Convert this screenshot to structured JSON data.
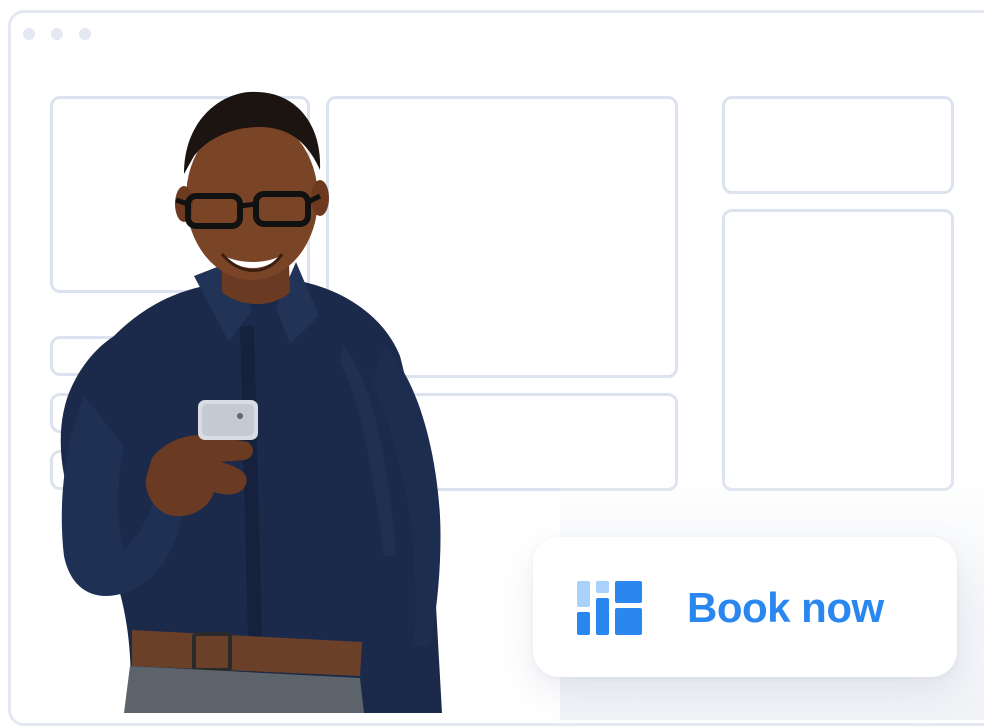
{
  "window": {
    "traffic_dots": [
      "dot",
      "dot",
      "dot"
    ]
  },
  "booking": {
    "label": "Book now",
    "icon": "calendar-blocks-icon",
    "accent_color": "#2a87ef",
    "accent_light_color": "#a9d1fb"
  },
  "photo": {
    "subject": "person-photo"
  }
}
